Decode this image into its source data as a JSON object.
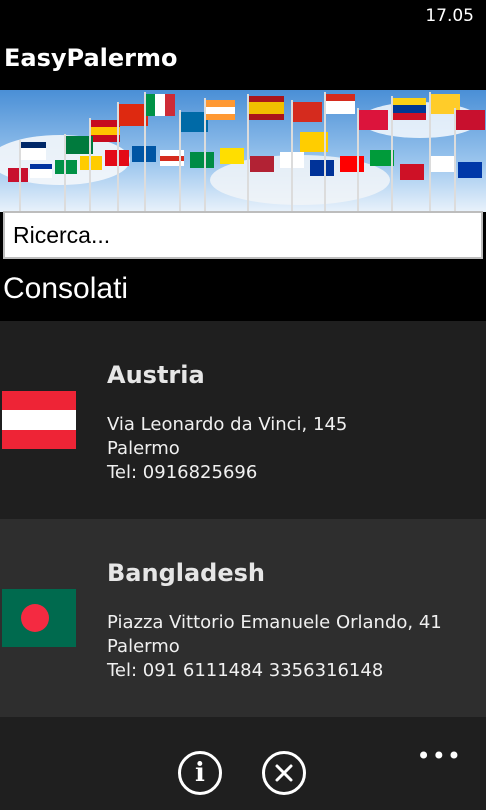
{
  "status_bar": {
    "time": "17.05"
  },
  "app": {
    "title": "EasyPalermo"
  },
  "search": {
    "placeholder": "Ricerca..."
  },
  "section": {
    "title": "Consolati"
  },
  "consulates": [
    {
      "country": "Austria",
      "address_line1": "Via Leonardo da Vinci, 145",
      "address_line2": "Palermo",
      "phone": "Tel: 0916825696",
      "flag_icon": "austria-flag-icon"
    },
    {
      "country": "Bangladesh",
      "address_line1": "Piazza Vittorio Emanuele Orlando, 41",
      "address_line2": "Palermo",
      "phone": "Tel: 091 6111484 3356316148",
      "flag_icon": "bangladesh-flag-icon"
    }
  ],
  "app_bar": {
    "buttons": [
      {
        "icon": "info-icon"
      },
      {
        "icon": "close-icon"
      }
    ],
    "more_icon": "more-dots-icon"
  },
  "colors": {
    "background": "#000000",
    "item_dark": "#1f1f1f",
    "item_light": "#2e2e2e",
    "austria_red": "#ee2436",
    "bangladesh_green": "#006a4e",
    "bangladesh_red": "#f42a41"
  }
}
